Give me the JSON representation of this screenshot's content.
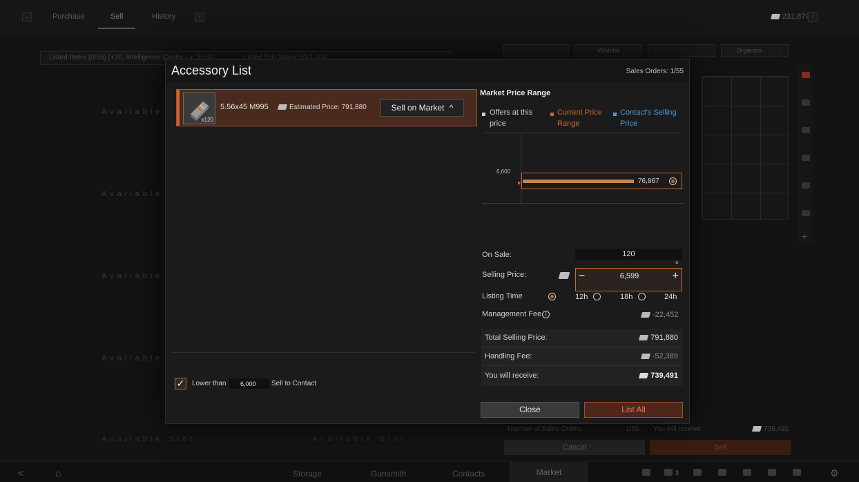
{
  "background": {
    "top_tabs": [
      "Purchase",
      "Sell",
      "History"
    ],
    "active_tab": "Sell",
    "currency": "231,879K",
    "listed_items": "Listed Items (0/55) (+20, Intelligence Center Lv. 3+10)",
    "listed_this_week": "Listed This Week: 53/1,200",
    "filter_buttons": [
      "Wishlist",
      "Organize"
    ],
    "available_slot": "Available Slot",
    "number_of_sales_orders_label": "Number of Sales Orders",
    "number_of_sales_orders_value": "1/55",
    "you_will_receive_label": "You will receive:",
    "you_will_receive_value": "739,491",
    "cancel_label": "Cancel",
    "sell_label": "Sell",
    "bottom_nav": [
      "Storage",
      "Gunsmith",
      "Contacts",
      "Market"
    ],
    "active_nav": "Market",
    "bottom_count": "3"
  },
  "modal": {
    "title": "Accessory List",
    "sales_orders": "Sales Orders: 1/55",
    "item": {
      "name": "5.56x45 M995",
      "count": "x120",
      "estimated_price": "Estimated Price: 791,880",
      "sell_button": "Sell on Market",
      "sell_chevron": "^"
    },
    "lower_than": {
      "checked": true,
      "label": "Lower than",
      "value": "6,000",
      "suffix": "Sell to Contact"
    },
    "market": {
      "title": "Market Price Range",
      "legend": [
        {
          "label": "Offers at this price",
          "color": "#cfcfcf"
        },
        {
          "label": "Current Price Range",
          "color": "#d0642e"
        },
        {
          "label": "Contact's Selling Price",
          "color": "#4a9cd8"
        }
      ],
      "chart_price": "6,600",
      "chart_offers": "76,867",
      "chart_fill_fraction": 0.7
    },
    "on_sale_label": "On Sale:",
    "on_sale_value": "120",
    "on_sale_clear": "×",
    "selling_price_label": "Selling Price:",
    "selling_price_value": "6,599",
    "stepper_minus": "−",
    "stepper_plus": "+",
    "listing_time_label": "Listing Time",
    "listing_options": [
      "12h",
      "18h",
      "24h"
    ],
    "listing_selected": "12h",
    "management_fee_label": "Management Fee",
    "management_fee_value": "-22,452",
    "total_selling_label": "Total Selling Price:",
    "total_selling_value": "791,880",
    "handling_fee_label": "Handling Fee:",
    "handling_fee_value": "-52,389",
    "receive_label": "You will receive:",
    "receive_value": "739,491",
    "close_label": "Close",
    "list_all_label": "List All"
  },
  "colors": {
    "accent": "#d0642e",
    "blue": "#4a9cd8"
  }
}
